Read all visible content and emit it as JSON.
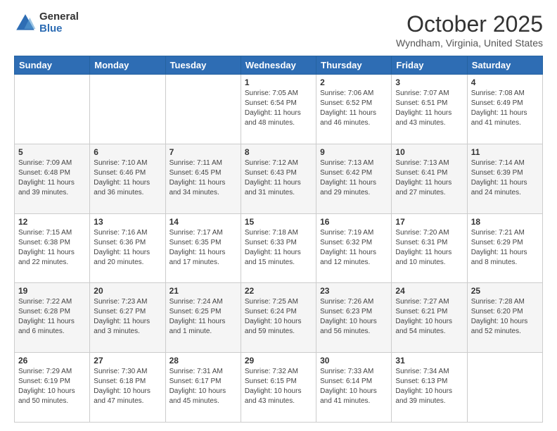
{
  "logo": {
    "general": "General",
    "blue": "Blue"
  },
  "header": {
    "month": "October 2025",
    "location": "Wyndham, Virginia, United States"
  },
  "weekdays": [
    "Sunday",
    "Monday",
    "Tuesday",
    "Wednesday",
    "Thursday",
    "Friday",
    "Saturday"
  ],
  "weeks": [
    [
      {
        "day": "",
        "info": ""
      },
      {
        "day": "",
        "info": ""
      },
      {
        "day": "",
        "info": ""
      },
      {
        "day": "1",
        "info": "Sunrise: 7:05 AM\nSunset: 6:54 PM\nDaylight: 11 hours and 48 minutes."
      },
      {
        "day": "2",
        "info": "Sunrise: 7:06 AM\nSunset: 6:52 PM\nDaylight: 11 hours and 46 minutes."
      },
      {
        "day": "3",
        "info": "Sunrise: 7:07 AM\nSunset: 6:51 PM\nDaylight: 11 hours and 43 minutes."
      },
      {
        "day": "4",
        "info": "Sunrise: 7:08 AM\nSunset: 6:49 PM\nDaylight: 11 hours and 41 minutes."
      }
    ],
    [
      {
        "day": "5",
        "info": "Sunrise: 7:09 AM\nSunset: 6:48 PM\nDaylight: 11 hours and 39 minutes."
      },
      {
        "day": "6",
        "info": "Sunrise: 7:10 AM\nSunset: 6:46 PM\nDaylight: 11 hours and 36 minutes."
      },
      {
        "day": "7",
        "info": "Sunrise: 7:11 AM\nSunset: 6:45 PM\nDaylight: 11 hours and 34 minutes."
      },
      {
        "day": "8",
        "info": "Sunrise: 7:12 AM\nSunset: 6:43 PM\nDaylight: 11 hours and 31 minutes."
      },
      {
        "day": "9",
        "info": "Sunrise: 7:13 AM\nSunset: 6:42 PM\nDaylight: 11 hours and 29 minutes."
      },
      {
        "day": "10",
        "info": "Sunrise: 7:13 AM\nSunset: 6:41 PM\nDaylight: 11 hours and 27 minutes."
      },
      {
        "day": "11",
        "info": "Sunrise: 7:14 AM\nSunset: 6:39 PM\nDaylight: 11 hours and 24 minutes."
      }
    ],
    [
      {
        "day": "12",
        "info": "Sunrise: 7:15 AM\nSunset: 6:38 PM\nDaylight: 11 hours and 22 minutes."
      },
      {
        "day": "13",
        "info": "Sunrise: 7:16 AM\nSunset: 6:36 PM\nDaylight: 11 hours and 20 minutes."
      },
      {
        "day": "14",
        "info": "Sunrise: 7:17 AM\nSunset: 6:35 PM\nDaylight: 11 hours and 17 minutes."
      },
      {
        "day": "15",
        "info": "Sunrise: 7:18 AM\nSunset: 6:33 PM\nDaylight: 11 hours and 15 minutes."
      },
      {
        "day": "16",
        "info": "Sunrise: 7:19 AM\nSunset: 6:32 PM\nDaylight: 11 hours and 12 minutes."
      },
      {
        "day": "17",
        "info": "Sunrise: 7:20 AM\nSunset: 6:31 PM\nDaylight: 11 hours and 10 minutes."
      },
      {
        "day": "18",
        "info": "Sunrise: 7:21 AM\nSunset: 6:29 PM\nDaylight: 11 hours and 8 minutes."
      }
    ],
    [
      {
        "day": "19",
        "info": "Sunrise: 7:22 AM\nSunset: 6:28 PM\nDaylight: 11 hours and 6 minutes."
      },
      {
        "day": "20",
        "info": "Sunrise: 7:23 AM\nSunset: 6:27 PM\nDaylight: 11 hours and 3 minutes."
      },
      {
        "day": "21",
        "info": "Sunrise: 7:24 AM\nSunset: 6:25 PM\nDaylight: 11 hours and 1 minute."
      },
      {
        "day": "22",
        "info": "Sunrise: 7:25 AM\nSunset: 6:24 PM\nDaylight: 10 hours and 59 minutes."
      },
      {
        "day": "23",
        "info": "Sunrise: 7:26 AM\nSunset: 6:23 PM\nDaylight: 10 hours and 56 minutes."
      },
      {
        "day": "24",
        "info": "Sunrise: 7:27 AM\nSunset: 6:21 PM\nDaylight: 10 hours and 54 minutes."
      },
      {
        "day": "25",
        "info": "Sunrise: 7:28 AM\nSunset: 6:20 PM\nDaylight: 10 hours and 52 minutes."
      }
    ],
    [
      {
        "day": "26",
        "info": "Sunrise: 7:29 AM\nSunset: 6:19 PM\nDaylight: 10 hours and 50 minutes."
      },
      {
        "day": "27",
        "info": "Sunrise: 7:30 AM\nSunset: 6:18 PM\nDaylight: 10 hours and 47 minutes."
      },
      {
        "day": "28",
        "info": "Sunrise: 7:31 AM\nSunset: 6:17 PM\nDaylight: 10 hours and 45 minutes."
      },
      {
        "day": "29",
        "info": "Sunrise: 7:32 AM\nSunset: 6:15 PM\nDaylight: 10 hours and 43 minutes."
      },
      {
        "day": "30",
        "info": "Sunrise: 7:33 AM\nSunset: 6:14 PM\nDaylight: 10 hours and 41 minutes."
      },
      {
        "day": "31",
        "info": "Sunrise: 7:34 AM\nSunset: 6:13 PM\nDaylight: 10 hours and 39 minutes."
      },
      {
        "day": "",
        "info": ""
      }
    ]
  ]
}
